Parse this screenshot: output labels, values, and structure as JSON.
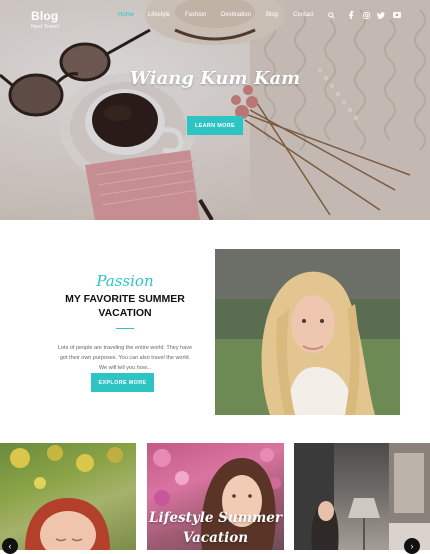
{
  "brand": {
    "title": "Blog",
    "subtitle": "Next Travel"
  },
  "nav": {
    "items": [
      {
        "label": "Home",
        "active": true
      },
      {
        "label": "Lifestyle"
      },
      {
        "label": "Fashion"
      },
      {
        "label": "Destination"
      },
      {
        "label": "Blog"
      },
      {
        "label": "Contact"
      }
    ],
    "icons": [
      "search-icon",
      "facebook-icon",
      "instagram-icon",
      "twitter-icon",
      "youtube-icon"
    ]
  },
  "hero": {
    "title": "Wiang Kum Kam",
    "button_label": "LEARN MORE"
  },
  "feature": {
    "kicker": "Passion",
    "heading_line1": "MY FAVORITE SUMMER",
    "heading_line2": "VACATION",
    "body_line1": "Lots of people are traveling the entire world. They have",
    "body_line2": "got their own purposes. You can also travel the world.",
    "body_line3": "We will tell you how...",
    "button_label": "EXPLORE MORE"
  },
  "cards": [
    {
      "title": ""
    },
    {
      "title_line1": "Lifestyle Summer",
      "title_line2": "Vacation"
    },
    {
      "title": ""
    }
  ],
  "colors": {
    "accent": "#2ec4c4",
    "text_dark": "#111111",
    "text_body": "#666666"
  }
}
